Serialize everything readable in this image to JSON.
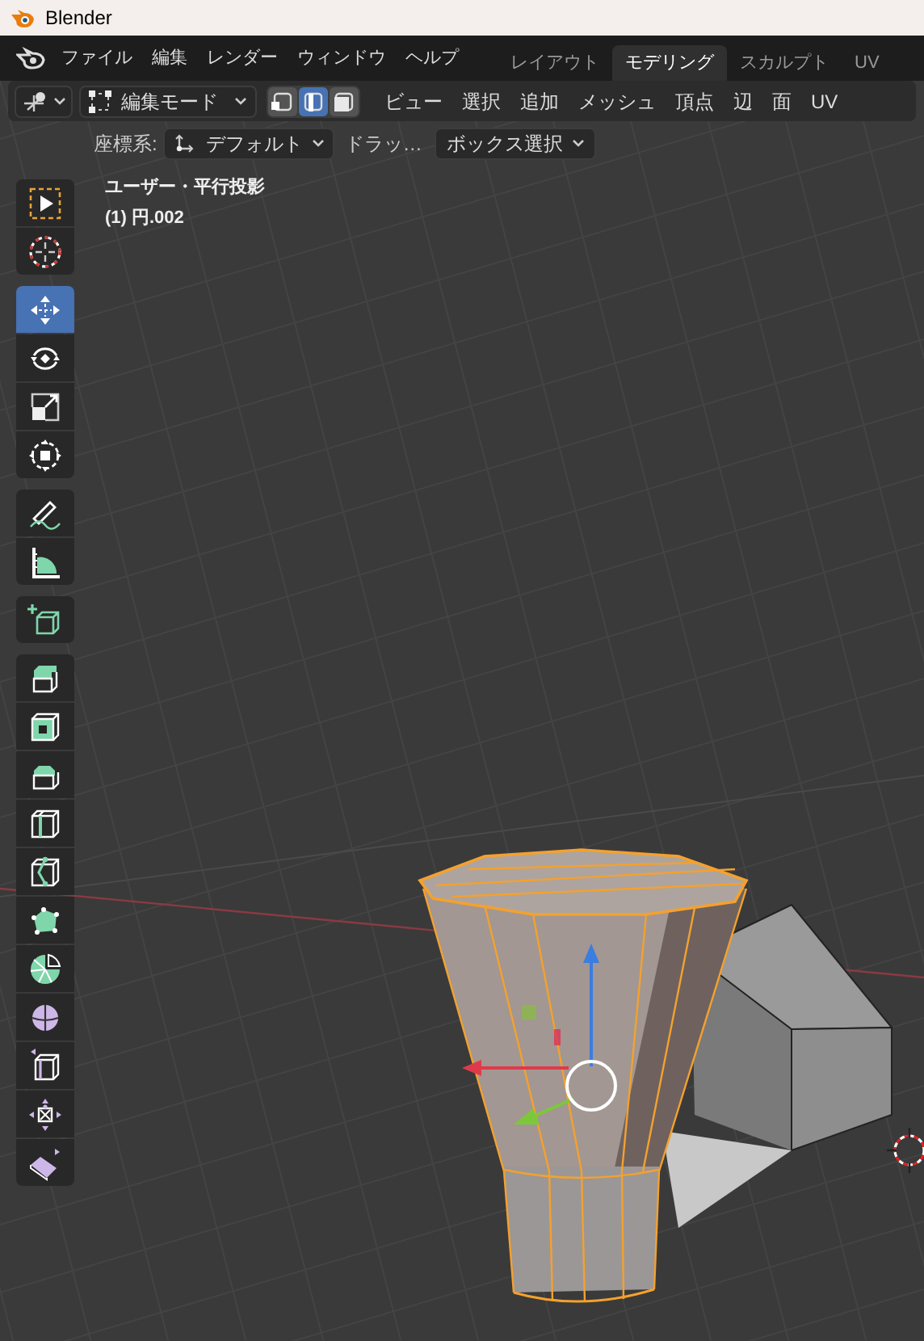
{
  "window": {
    "title": "Blender"
  },
  "menu_bar": {
    "menus": [
      "ファイル",
      "編集",
      "レンダー",
      "ウィンドウ",
      "ヘルプ"
    ],
    "workspace_tabs": [
      {
        "label": "レイアウト",
        "selected": false
      },
      {
        "label": "モデリング",
        "selected": true
      },
      {
        "label": "スカルプト",
        "selected": false
      },
      {
        "label": "UV",
        "selected": false
      }
    ]
  },
  "header": {
    "mode": "編集モード",
    "select_modes": [
      {
        "kind": "vertex",
        "selected": false
      },
      {
        "kind": "edge",
        "selected": true
      },
      {
        "kind": "face",
        "selected": false
      }
    ],
    "menus": [
      "ビュー",
      "選択",
      "追加",
      "メッシュ",
      "頂点",
      "辺",
      "面",
      "UV"
    ]
  },
  "tool_settings": {
    "orientation_label": "座標系:",
    "orientation": "デフォルト",
    "drag_label": "ドラッ…",
    "drag": "ボックス選択"
  },
  "viewport": {
    "view_name": "ユーザー・平行投影",
    "object_name": "(1) 円.002"
  },
  "toolbar": [
    [
      {
        "kind": "select",
        "selected": false
      },
      {
        "kind": "cursor",
        "selected": false
      }
    ],
    [
      {
        "kind": "move",
        "selected": true
      },
      {
        "kind": "rotate",
        "selected": false
      },
      {
        "kind": "scale",
        "selected": false
      },
      {
        "kind": "transform",
        "selected": false
      }
    ],
    [
      {
        "kind": "annotate",
        "selected": false
      },
      {
        "kind": "measure",
        "selected": false
      }
    ],
    [
      {
        "kind": "add-cube",
        "selected": false
      }
    ],
    [
      {
        "kind": "extrude",
        "selected": false
      },
      {
        "kind": "inset",
        "selected": false
      },
      {
        "kind": "bevel",
        "selected": false
      },
      {
        "kind": "loop-cut",
        "selected": false
      },
      {
        "kind": "knife",
        "selected": false
      },
      {
        "kind": "poly-build",
        "selected": false
      },
      {
        "kind": "spin",
        "selected": false
      },
      {
        "kind": "smooth",
        "selected": false
      },
      {
        "kind": "edge-slide",
        "selected": false
      },
      {
        "kind": "shrink",
        "selected": false
      },
      {
        "kind": "shear",
        "selected": false
      }
    ]
  ]
}
